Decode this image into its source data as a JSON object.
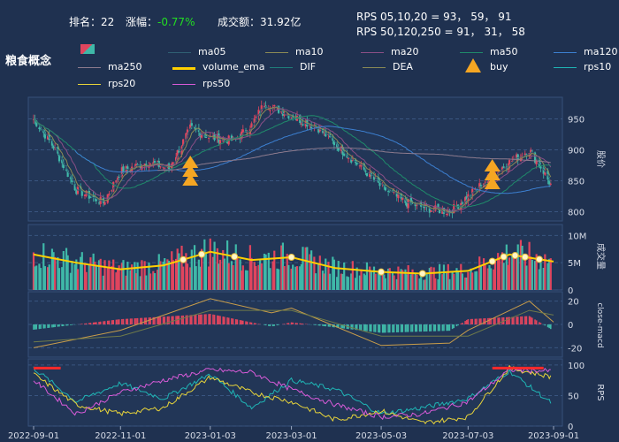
{
  "header": {
    "rank_label": "排名：",
    "rank_value": "22",
    "change_label": "涨幅：",
    "change_value": "-0.77%",
    "volume_label": "成交额：",
    "volume_value": "31.92亿",
    "rps_line1": "RPS 05,10,20 = 93， 59， 91",
    "rps_line2": "RPS 50,120,250 = 91， 31， 58"
  },
  "title": "粮食概念",
  "legend": [
    {
      "name": "ma05",
      "color": "#2f5f73"
    },
    {
      "name": "ma10",
      "color": "#8a8a55"
    },
    {
      "name": "ma20",
      "color": "#8a4f86"
    },
    {
      "name": "ma50",
      "color": "#1f8a6a"
    },
    {
      "name": "ma120",
      "color": "#3c7fd0"
    },
    {
      "name": "ma250",
      "color": "#8d7b8e"
    },
    {
      "name": "volume_ema",
      "color": "#ffd000"
    },
    {
      "name": "DIF",
      "color": "#1f7f7a"
    },
    {
      "name": "DEA",
      "color": "#8a8a55"
    },
    {
      "name": "buy",
      "color": "#f5a623"
    },
    {
      "name": "rps10",
      "color": "#1fb5b5"
    },
    {
      "name": "rps20",
      "color": "#e8d43a"
    },
    {
      "name": "rps50",
      "color": "#d85bd8"
    }
  ],
  "chart_data": [
    {
      "type": "candlestick",
      "panel": "price",
      "ylabel": "股价",
      "ylim": [
        785,
        985
      ],
      "yticks": [
        800,
        850,
        900,
        950
      ],
      "xticks": [
        "2022-09-01",
        "2022-11-01",
        "2023-01-03",
        "2023-03-01",
        "2023-05-03",
        "2023-07-03",
        "2023-09-01"
      ],
      "close_series": [
        {
          "date": "2022-09-01",
          "value": 950
        },
        {
          "date": "2022-09-15",
          "value": 905
        },
        {
          "date": "2022-10-01",
          "value": 835
        },
        {
          "date": "2022-10-20",
          "value": 815
        },
        {
          "date": "2022-11-01",
          "value": 865
        },
        {
          "date": "2022-11-20",
          "value": 880
        },
        {
          "date": "2022-12-05",
          "value": 870
        },
        {
          "date": "2022-12-20",
          "value": 935
        },
        {
          "date": "2023-01-03",
          "value": 920
        },
        {
          "date": "2023-01-20",
          "value": 915
        },
        {
          "date": "2023-02-01",
          "value": 940
        },
        {
          "date": "2023-02-10",
          "value": 975
        },
        {
          "date": "2023-03-01",
          "value": 955
        },
        {
          "date": "2023-03-20",
          "value": 935
        },
        {
          "date": "2023-04-05",
          "value": 900
        },
        {
          "date": "2023-04-20",
          "value": 870
        },
        {
          "date": "2023-05-03",
          "value": 840
        },
        {
          "date": "2023-05-20",
          "value": 815
        },
        {
          "date": "2023-06-05",
          "value": 805
        },
        {
          "date": "2023-06-20",
          "value": 800
        },
        {
          "date": "2023-07-03",
          "value": 825
        },
        {
          "date": "2023-07-20",
          "value": 860
        },
        {
          "date": "2023-08-01",
          "value": 880
        },
        {
          "date": "2023-08-15",
          "value": 900
        },
        {
          "date": "2023-08-25",
          "value": 865
        },
        {
          "date": "2023-09-01",
          "value": 835
        }
      ],
      "buy_signals": [
        {
          "date": "2022-12-20",
          "count": 3
        },
        {
          "date": "2023-07-20",
          "count": 3
        }
      ]
    },
    {
      "type": "bar",
      "panel": "volume",
      "ylabel": "成交量",
      "yticks": [
        "0",
        "5M",
        "10M"
      ],
      "ylim": [
        0,
        12
      ],
      "volume_ema": [
        {
          "date": "2022-09-01",
          "value": 6.5
        },
        {
          "date": "2022-10-01",
          "value": 5.0
        },
        {
          "date": "2022-11-01",
          "value": 3.8
        },
        {
          "date": "2022-12-01",
          "value": 4.5
        },
        {
          "date": "2023-01-03",
          "value": 7.0
        },
        {
          "date": "2023-02-01",
          "value": 5.5
        },
        {
          "date": "2023-03-01",
          "value": 6.0
        },
        {
          "date": "2023-04-01",
          "value": 4.0
        },
        {
          "date": "2023-05-03",
          "value": 3.3
        },
        {
          "date": "2023-06-01",
          "value": 3.0
        },
        {
          "date": "2023-07-03",
          "value": 3.5
        },
        {
          "date": "2023-08-01",
          "value": 6.5
        },
        {
          "date": "2023-09-01",
          "value": 5.2
        }
      ]
    },
    {
      "type": "bar",
      "panel": "macd",
      "ylabel": "close-macd",
      "yticks": [
        -20,
        0,
        20
      ],
      "ylim": [
        -28,
        28
      ],
      "dif": [
        {
          "date": "2022-09-01",
          "value": -20
        },
        {
          "date": "2022-11-01",
          "value": -5
        },
        {
          "date": "2023-01-03",
          "value": 22
        },
        {
          "date": "2023-02-15",
          "value": 10
        },
        {
          "date": "2023-03-01",
          "value": 14
        },
        {
          "date": "2023-05-03",
          "value": -18
        },
        {
          "date": "2023-06-20",
          "value": -16
        },
        {
          "date": "2023-07-03",
          "value": -5
        },
        {
          "date": "2023-08-15",
          "value": 20
        },
        {
          "date": "2023-09-01",
          "value": 2
        }
      ],
      "dea": [
        {
          "date": "2022-09-01",
          "value": -15
        },
        {
          "date": "2022-11-01",
          "value": -10
        },
        {
          "date": "2023-01-03",
          "value": 12
        },
        {
          "date": "2023-03-01",
          "value": 12
        },
        {
          "date": "2023-05-03",
          "value": -10
        },
        {
          "date": "2023-07-03",
          "value": -10
        },
        {
          "date": "2023-08-15",
          "value": 12
        },
        {
          "date": "2023-09-01",
          "value": 8
        }
      ]
    },
    {
      "type": "line",
      "panel": "rps",
      "ylabel": "RPS",
      "yticks": [
        0,
        50,
        100
      ],
      "ylim": [
        0,
        110
      ],
      "series": [
        {
          "name": "rps10",
          "points": [
            {
              "date": "2022-09-01",
              "value": 95
            },
            {
              "date": "2022-10-01",
              "value": 40
            },
            {
              "date": "2022-11-01",
              "value": 70
            },
            {
              "date": "2022-12-01",
              "value": 45
            },
            {
              "date": "2023-01-03",
              "value": 85
            },
            {
              "date": "2023-02-01",
              "value": 30
            },
            {
              "date": "2023-03-01",
              "value": 75
            },
            {
              "date": "2023-04-01",
              "value": 60
            },
            {
              "date": "2023-05-03",
              "value": 20
            },
            {
              "date": "2023-06-01",
              "value": 30
            },
            {
              "date": "2023-07-03",
              "value": 45
            },
            {
              "date": "2023-08-01",
              "value": 90
            },
            {
              "date": "2023-09-01",
              "value": 35
            }
          ]
        },
        {
          "name": "rps20",
          "points": [
            {
              "date": "2022-09-01",
              "value": 85
            },
            {
              "date": "2022-10-01",
              "value": 35
            },
            {
              "date": "2022-11-01",
              "value": 20
            },
            {
              "date": "2022-12-01",
              "value": 30
            },
            {
              "date": "2023-01-03",
              "value": 80
            },
            {
              "date": "2023-02-01",
              "value": 55
            },
            {
              "date": "2023-03-01",
              "value": 40
            },
            {
              "date": "2023-04-01",
              "value": 10
            },
            {
              "date": "2023-05-03",
              "value": 25
            },
            {
              "date": "2023-06-01",
              "value": 5
            },
            {
              "date": "2023-07-03",
              "value": 15
            },
            {
              "date": "2023-08-01",
              "value": 95
            },
            {
              "date": "2023-09-01",
              "value": 80
            }
          ]
        },
        {
          "name": "rps50",
          "points": [
            {
              "date": "2022-09-01",
              "value": 75
            },
            {
              "date": "2022-10-01",
              "value": 20
            },
            {
              "date": "2022-11-01",
              "value": 55
            },
            {
              "date": "2022-12-01",
              "value": 75
            },
            {
              "date": "2023-01-03",
              "value": 92
            },
            {
              "date": "2023-02-01",
              "value": 88
            },
            {
              "date": "2023-03-01",
              "value": 60
            },
            {
              "date": "2023-04-01",
              "value": 35
            },
            {
              "date": "2023-05-03",
              "value": 15
            },
            {
              "date": "2023-06-01",
              "value": 20
            },
            {
              "date": "2023-07-03",
              "value": 40
            },
            {
              "date": "2023-08-01",
              "value": 92
            },
            {
              "date": "2023-09-01",
              "value": 90
            }
          ]
        }
      ]
    }
  ]
}
